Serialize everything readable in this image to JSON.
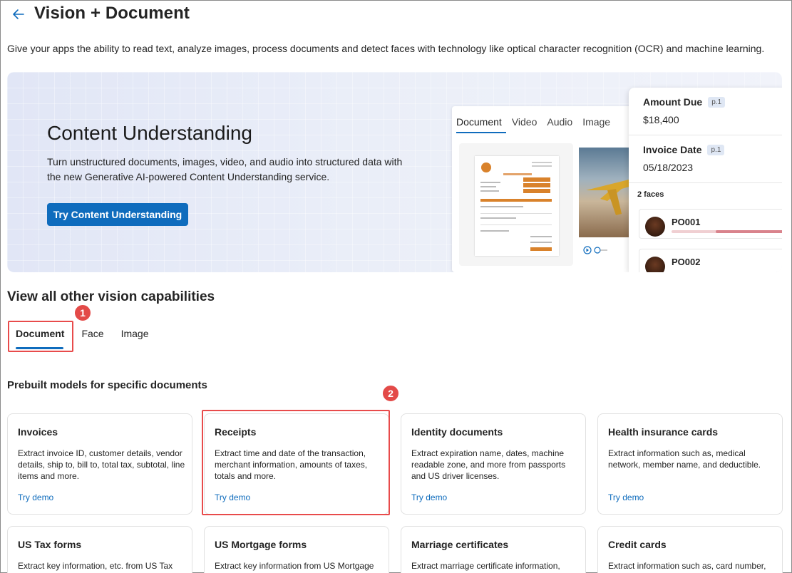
{
  "header": {
    "title": "Vision + Document",
    "description": "Give your apps the ability to read text, analyze images, process documents and detect faces with technology like optical character recognition (OCR) and machine learning."
  },
  "hero": {
    "title": "Content Understanding",
    "description": "Turn unstructured documents, images, video, and audio into structured data with the new Generative AI-powered Content Understanding service.",
    "button_label": "Try Content Understanding",
    "preview_tabs": [
      "Document",
      "Video",
      "Audio",
      "Image"
    ],
    "preview_active_tab": "Document",
    "fields": [
      {
        "label": "Amount Due",
        "page": "p.1",
        "value": "$18,400"
      },
      {
        "label": "Invoice Date",
        "page": "p.1",
        "value": "05/18/2023"
      }
    ],
    "faces_count": "2 faces",
    "faces": [
      {
        "name": "PO001"
      },
      {
        "name": "PO002"
      }
    ]
  },
  "capabilities": {
    "title": "View all other vision capabilities",
    "tabs": [
      "Document",
      "Face",
      "Image"
    ],
    "active_tab": "Document",
    "subheading": "Prebuilt models for specific documents",
    "cards": [
      {
        "title": "Invoices",
        "description": "Extract invoice ID, customer details, vendor details, ship to, bill to, total tax, subtotal, line items and more.",
        "link": "Try demo"
      },
      {
        "title": "Receipts",
        "description": "Extract time and date of the transaction, merchant information, amounts of taxes, totals and more.",
        "link": "Try demo"
      },
      {
        "title": "Identity documents",
        "description": "Extract expiration name, dates, machine readable zone, and more from passports and US driver licenses.",
        "link": "Try demo"
      },
      {
        "title": "Health insurance cards",
        "description": "Extract information such as, medical network, member name, and deductible.",
        "link": "Try demo"
      },
      {
        "title": "US Tax forms",
        "description": "Extract key information, etc. from US Tax",
        "link": ""
      },
      {
        "title": "US Mortgage forms",
        "description": "Extract key information from US Mortgage",
        "link": ""
      },
      {
        "title": "Marriage certificates",
        "description": "Extract marriage certificate information,",
        "link": ""
      },
      {
        "title": "Credit cards",
        "description": "Extract information such as, card number,",
        "link": ""
      }
    ]
  },
  "callouts": [
    "1",
    "2"
  ],
  "colors": {
    "accent": "#0f6cbd",
    "callout": "#e34a48"
  }
}
